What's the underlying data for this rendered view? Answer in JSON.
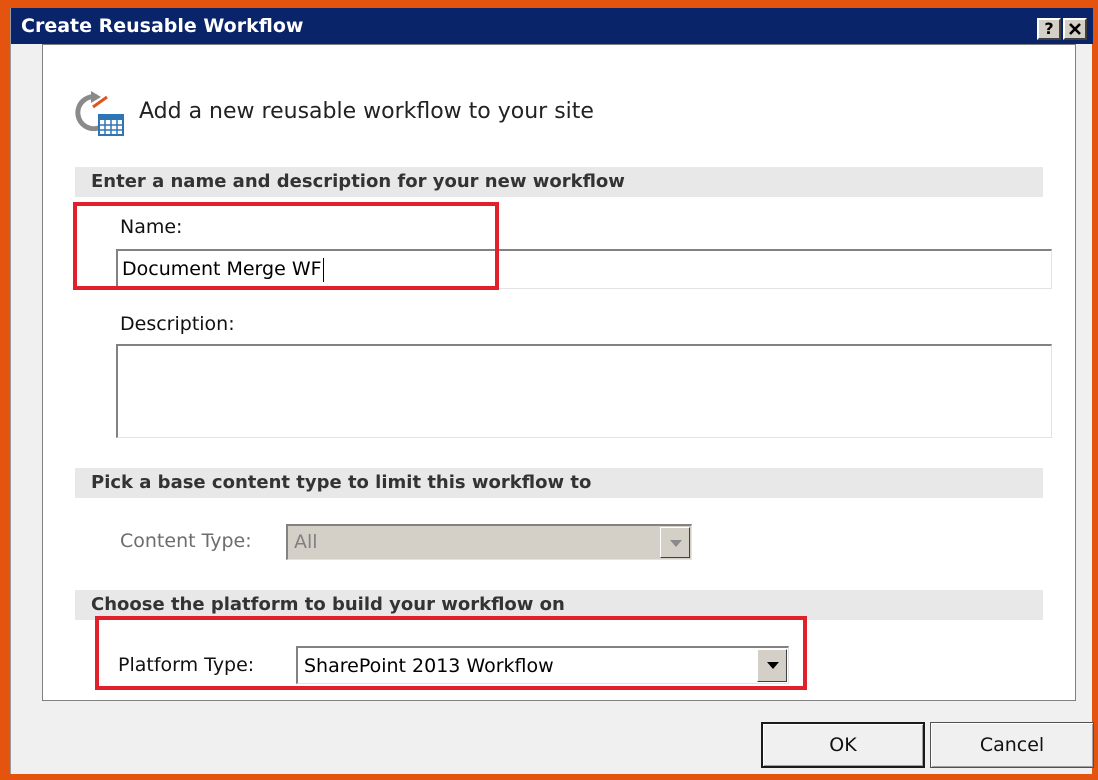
{
  "window": {
    "title": "Create Reusable Workflow",
    "help_label": "?",
    "close_label": "✕"
  },
  "header": {
    "text": "Add a new reusable workflow to your site"
  },
  "sections": {
    "name_desc": "Enter a name and description for your new workflow",
    "content_type": "Pick a base content type to limit this workflow to",
    "platform": "Choose the platform to build your workflow on"
  },
  "fields": {
    "name_label": "Name:",
    "name_value": "Document Merge WF",
    "description_label": "Description:",
    "description_value": "",
    "content_type_label": "Content Type:",
    "content_type_value": "All",
    "platform_label": "Platform Type:",
    "platform_value": "SharePoint 2013 Workflow"
  },
  "buttons": {
    "ok": "OK",
    "cancel": "Cancel"
  },
  "colors": {
    "titlebar": "#0a246a",
    "highlight": "#e0212b",
    "frame": "#e4540e"
  }
}
